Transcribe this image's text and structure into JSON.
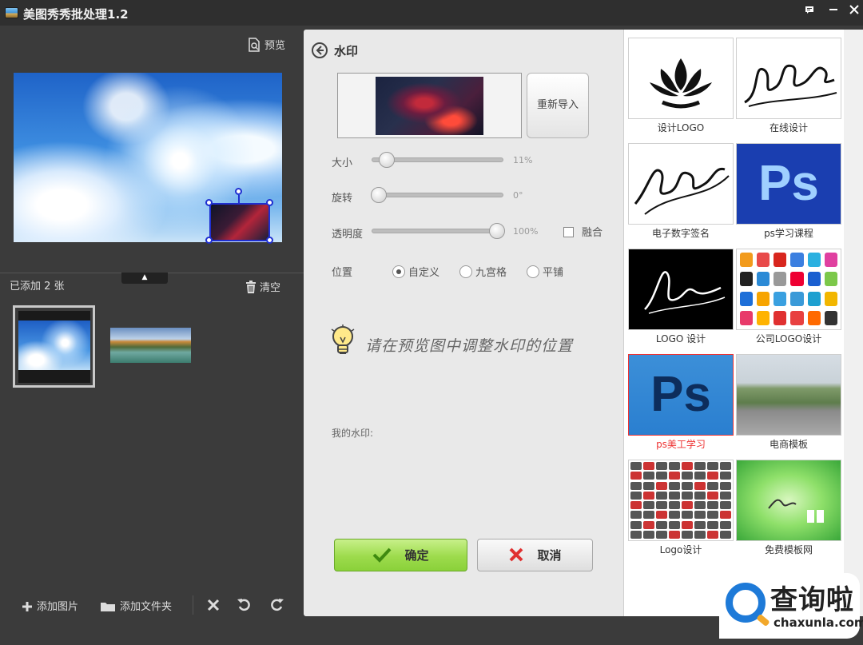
{
  "window": {
    "title": "美图秀秀批处理1.2",
    "controls": [
      "chat-icon",
      "minimize-icon",
      "close-icon"
    ]
  },
  "left_panel": {
    "preview_label": "预览",
    "added_count": "已添加 2 张",
    "clear_label": "清空",
    "thumbnails": [
      "sky-clouds-photo",
      "lake-landscape-photo"
    ],
    "toolbar": {
      "add_image": "添加图片",
      "add_folder": "添加文件夹"
    }
  },
  "watermark_panel": {
    "title": "水印",
    "reimport_label": "重新导入",
    "size": {
      "label": "大小",
      "value_text": "11%",
      "value": 0.11
    },
    "rotate": {
      "label": "旋转",
      "value_text": "0°",
      "value": 0
    },
    "opacity": {
      "label": "透明度",
      "value_text": "100%",
      "value": 1.0
    },
    "blend_label": "融合",
    "position": {
      "label": "位置",
      "options": [
        "自定义",
        "九宫格",
        "平铺"
      ],
      "selected": "自定义"
    },
    "tip": "请在预览图中调整水印的位置",
    "my_watermark_label": "我的水印:",
    "ok_label": "确定",
    "cancel_label": "取消"
  },
  "gallery": {
    "items": [
      {
        "caption": "设计LOGO"
      },
      {
        "caption": "在线设计"
      },
      {
        "caption": "电子数字签名"
      },
      {
        "caption": "ps学习课程"
      },
      {
        "caption": "LOGO 设计"
      },
      {
        "caption": "公司LOGO设计"
      },
      {
        "caption": "ps美工学习",
        "selected": true
      },
      {
        "caption": "电商模板"
      },
      {
        "caption": "Logo设计"
      },
      {
        "caption": "免费模板网"
      }
    ],
    "ps_text": "Ps"
  },
  "brand": {
    "name": "查询啦",
    "url": "chaxunla.com"
  },
  "colors": {
    "accent_green": "#8ad13a",
    "cancel_red": "#e03030",
    "selection_blue": "#1f2fd0",
    "brand_blue": "#1e7ad8"
  }
}
